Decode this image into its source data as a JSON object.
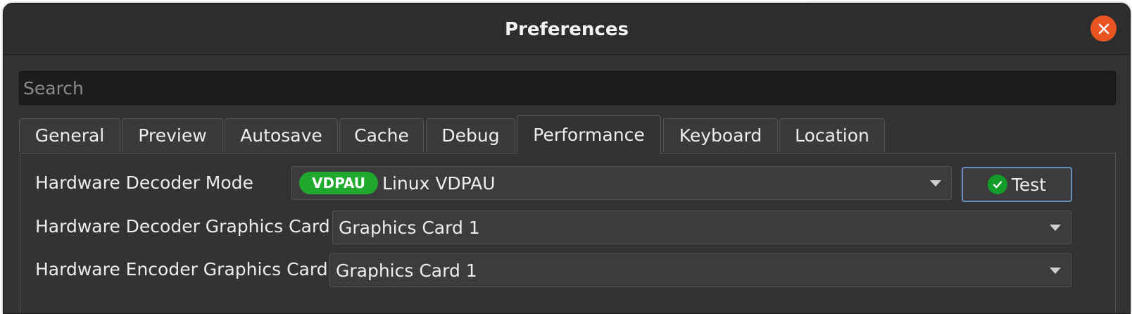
{
  "window": {
    "title": "Preferences"
  },
  "search": {
    "placeholder": "Search"
  },
  "tabs": [
    {
      "label": "General"
    },
    {
      "label": "Preview"
    },
    {
      "label": "Autosave"
    },
    {
      "label": "Cache"
    },
    {
      "label": "Debug"
    },
    {
      "label": "Performance",
      "active": true
    },
    {
      "label": "Keyboard"
    },
    {
      "label": "Location"
    }
  ],
  "performance": {
    "decoder_mode": {
      "label": "Hardware Decoder Mode",
      "badge": "VDPAU",
      "value": "Linux VDPAU",
      "test_label": "Test"
    },
    "decoder_card": {
      "label": "Hardware Decoder Graphics Card",
      "value": "Graphics Card 1"
    },
    "encoder_card": {
      "label": "Hardware Encoder Graphics Card",
      "value": "Graphics Card 1"
    }
  },
  "colors": {
    "close_button": "#e95420",
    "badge": "#1faa2e",
    "focus_border": "#6a8fbd"
  },
  "icons": {
    "close": "close-icon",
    "check": "check-circle-icon",
    "dropdown": "chevron-down-icon"
  }
}
